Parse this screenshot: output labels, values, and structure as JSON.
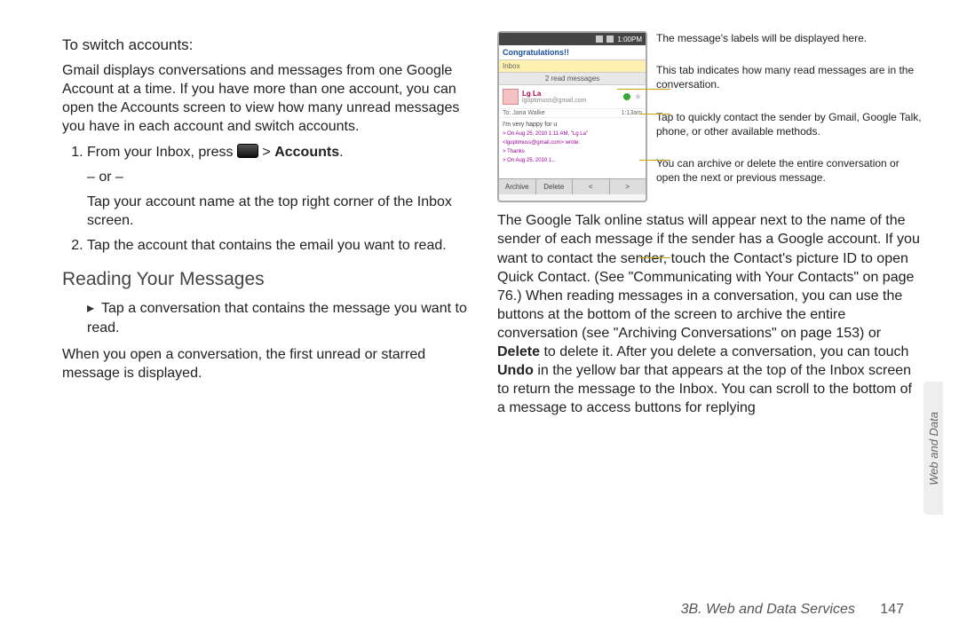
{
  "left": {
    "switch_heading": "To switch accounts:",
    "switch_intro": "Gmail displays conversations and messages from one Google Account at a time. If you have more than one account, you can open the Accounts screen to view how many unread messages you have in each account and switch accounts.",
    "step1_a": "From your Inbox, press ",
    "step1_b": " > ",
    "step1_c": "Accounts",
    "step1_or": "– or –",
    "step1_alt": "Tap your account name at the top right corner of the Inbox screen.",
    "step2": "Tap the account that contains the email you want to read.",
    "read_heading": "Reading Your Messages",
    "read_bullet": "Tap a conversation that contains the message you want to read.",
    "read_para": "When you open a conversation, the first unread or starred message is displayed."
  },
  "right": {
    "phone": {
      "time": "1:00PM",
      "subject": "Congratulations!!",
      "label": "Inbox",
      "read_tab": "2 read messages",
      "sender_name": "Lg La",
      "sender_email": "lgoptimuss@gmail.com",
      "to_line": "To: Jana Walke",
      "to_time": "1:13am",
      "body_text": "I'm very happy for u",
      "quote1": "> On Aug 25, 2010 1:11 AM, \"Lg La\"",
      "quote2": "<lgoptimuss@gmail.com> wrote:",
      "quote3": "> Thanks",
      "quote4": "> On Aug 25, 2010 1...",
      "btn_archive": "Archive",
      "btn_delete": "Delete",
      "btn_prev": "<",
      "btn_next": ">"
    },
    "callouts": {
      "c1": "The message's labels will be displayed here.",
      "c2": "This tab indicates how many read messages are in the conversation.",
      "c3": "Tap to quickly contact the sender by Gmail, Google Talk, phone, or other available methods.",
      "c4": "You can archive or delete the entire conversation or open the next or previous message."
    },
    "para_a": "The Google Talk online status will appear next to the name of the sender of each message if the sender has a Google account. If you want to contact the sender, touch the Contact's picture ID to open Quick Contact. (See \"Communicating with Your Contacts\" on page 76.) When reading messages in a conversation, you can use the buttons at the bottom of the screen to archive the entire conversation (see \"Archiving Conversations\" on page 153) or ",
    "para_b": "Delete",
    "para_c": " to delete it. After you delete a conversation, you can touch ",
    "para_d": "Undo",
    "para_e": " in the yellow bar that appears at the top of the Inbox screen to return the message to the Inbox. You can scroll to the bottom of a message to access buttons for replying"
  },
  "footer": {
    "section": "3B. Web and Data Services",
    "page": "147"
  },
  "sidetab": "Web and Data"
}
